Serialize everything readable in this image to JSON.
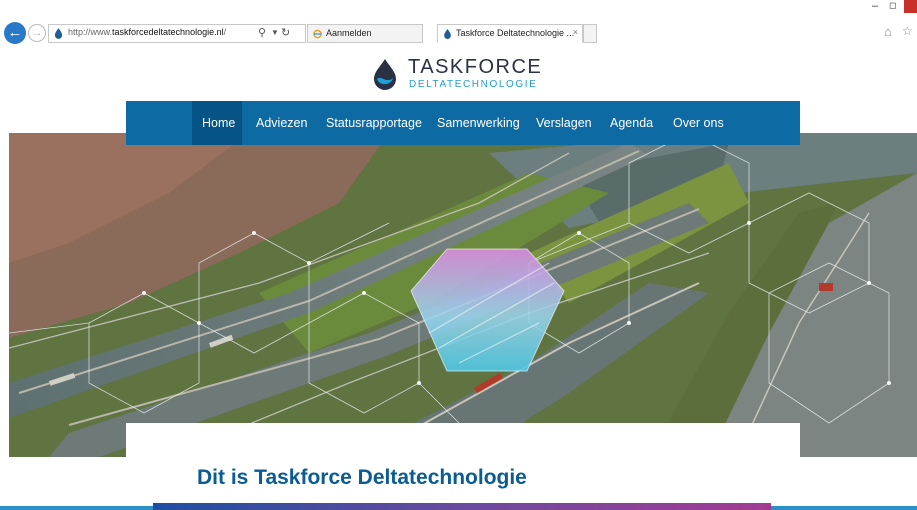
{
  "browser": {
    "url_prefix": "http://www.",
    "url_domain": "taskforcedeltatechnologie.nl",
    "url_suffix": "/",
    "tabs": [
      {
        "label": "Aanmelden"
      },
      {
        "label": "Taskforce Deltatechnologie ...",
        "close": "×"
      }
    ],
    "icons": [
      "back-arrow-icon",
      "forward-arrow-icon",
      "search-icon",
      "refresh-icon",
      "home-icon",
      "star-icon",
      "minimize-icon",
      "maximize-icon",
      "close-icon"
    ]
  },
  "site": {
    "logo_title": "TASKFORCE",
    "logo_subtitle": "DELTATECHNOLOGIE",
    "nav": [
      {
        "label": "Home",
        "active": true
      },
      {
        "label": "Adviezen"
      },
      {
        "label": "Statusrapportage"
      },
      {
        "label": "Samenwerking"
      },
      {
        "label": "Verslagen"
      },
      {
        "label": "Agenda"
      },
      {
        "label": "Over ons"
      }
    ],
    "page_title": "Dit is Taskforce Deltatechnologie"
  },
  "colors": {
    "nav_bg": "#0e6aa2",
    "nav_active": "#065486",
    "title": "#0b5c92",
    "logo_accent": "#1f9fd6"
  }
}
